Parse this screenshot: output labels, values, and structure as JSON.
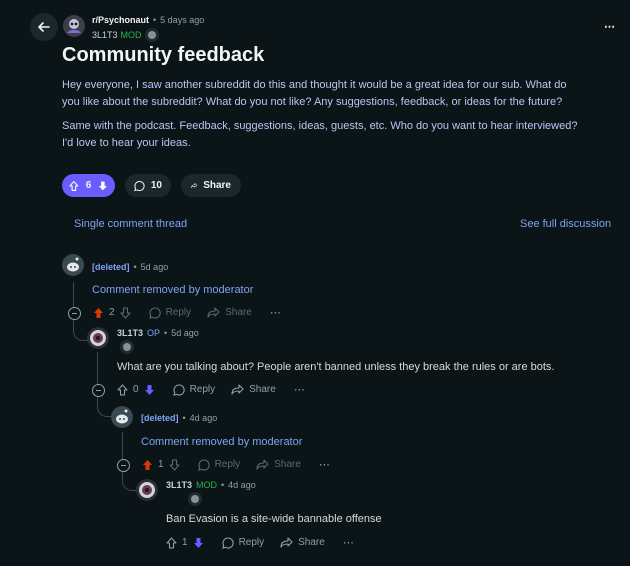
{
  "post": {
    "subreddit": "r/Psychonaut",
    "age": "5 days ago",
    "author": "3L1T3",
    "author_role": "MOD",
    "title": "Community feedback",
    "body_p1": "Hey everyone, I saw another subreddit do this and thought it would be a great idea for our sub. What do you like about the subreddit? What do you not like? Any suggestions, feedback, or ideas for the future?",
    "body_p2": "Same with the podcast. Feedback, suggestions, ideas, guests, etc. Who do you want to hear interviewed? I'd love to hear your ideas.",
    "votes": "6",
    "comments": "10",
    "share_label": "Share",
    "vote_state": "upvoted"
  },
  "header": {
    "more_label": "⋯"
  },
  "thread_nav": {
    "single_label": "Single comment thread",
    "full_label": "See full discussion"
  },
  "comments": [
    {
      "author": "[deleted]",
      "age": "5d ago",
      "text": "Comment removed by moderator",
      "votes": "2",
      "vote_state": "upvoted",
      "reply": "Reply",
      "share": "Share"
    },
    {
      "author": "3L1T3",
      "role": "OP",
      "age": "5d ago",
      "text": "What are you talking about? People aren't banned unless they break the rules or are bots.",
      "votes": "0",
      "vote_state": "downvoted",
      "reply": "Reply",
      "share": "Share"
    },
    {
      "author": "[deleted]",
      "age": "4d ago",
      "text": "Comment removed by moderator",
      "votes": "1",
      "vote_state": "upvoted",
      "reply": "Reply",
      "share": "Share"
    },
    {
      "author": "3L1T3",
      "role": "MOD",
      "age": "4d ago",
      "text": "Ban Evasion is a site-wide bannable offense",
      "votes": "1",
      "vote_state": "downvoted",
      "reply": "Reply",
      "share": "Share"
    }
  ],
  "colors": {
    "background": "#0b1416",
    "accent_vote": "#6a5cff",
    "upvote_red": "#d93a00",
    "downvote_purple": "#6a5cff",
    "link_blue": "#7ea4f5",
    "mod_green": "#2ab34a"
  }
}
